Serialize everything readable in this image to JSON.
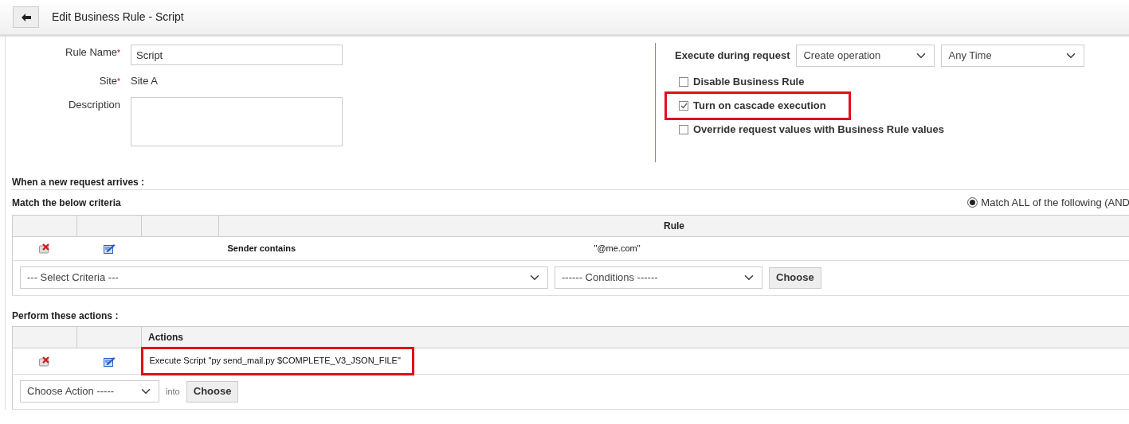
{
  "header": {
    "title": "Edit Business Rule - Script"
  },
  "form": {
    "fields": [
      {
        "kind": "text",
        "label": "Rule Name",
        "asterisk": "*",
        "value": "Script"
      },
      {
        "kind": "static",
        "label": "Site",
        "asterisk": "*",
        "value": "Site A"
      },
      {
        "kind": "textarea",
        "label": "Description"
      }
    ]
  },
  "execution": {
    "label": "Execute during request",
    "selects": [
      "Create operation",
      "Any Time"
    ],
    "options": [
      {
        "label": "Disable Business Rule",
        "checked": false,
        "highlighted": false
      },
      {
        "label": "Turn on cascade execution",
        "checked": true,
        "highlighted": true
      },
      {
        "label": "Override request values with Business Rule values",
        "checked": false,
        "highlighted": false
      }
    ]
  },
  "criteria": {
    "heading": "When a new request arrives :",
    "subheading": "Match the below criteria",
    "match_mode": {
      "label": "Match ALL of the following (AND",
      "selected": true
    },
    "rule_header": "Rule",
    "rows": [
      {
        "field": "Sender contains",
        "value": "\"@me.com\""
      }
    ],
    "criteria_select": "--- Select Criteria ---",
    "conditions_select": "------ Conditions ------",
    "button": "Choose"
  },
  "actions": {
    "heading": "Perform these actions :",
    "header": "Actions",
    "rows": [
      {
        "text": "Execute Script \"py send_mail.py $COMPLETE_V3_JSON_FILE\"",
        "highlighted": true
      }
    ],
    "action_select": "Choose Action -----",
    "into": "into",
    "button": "Choose"
  }
}
